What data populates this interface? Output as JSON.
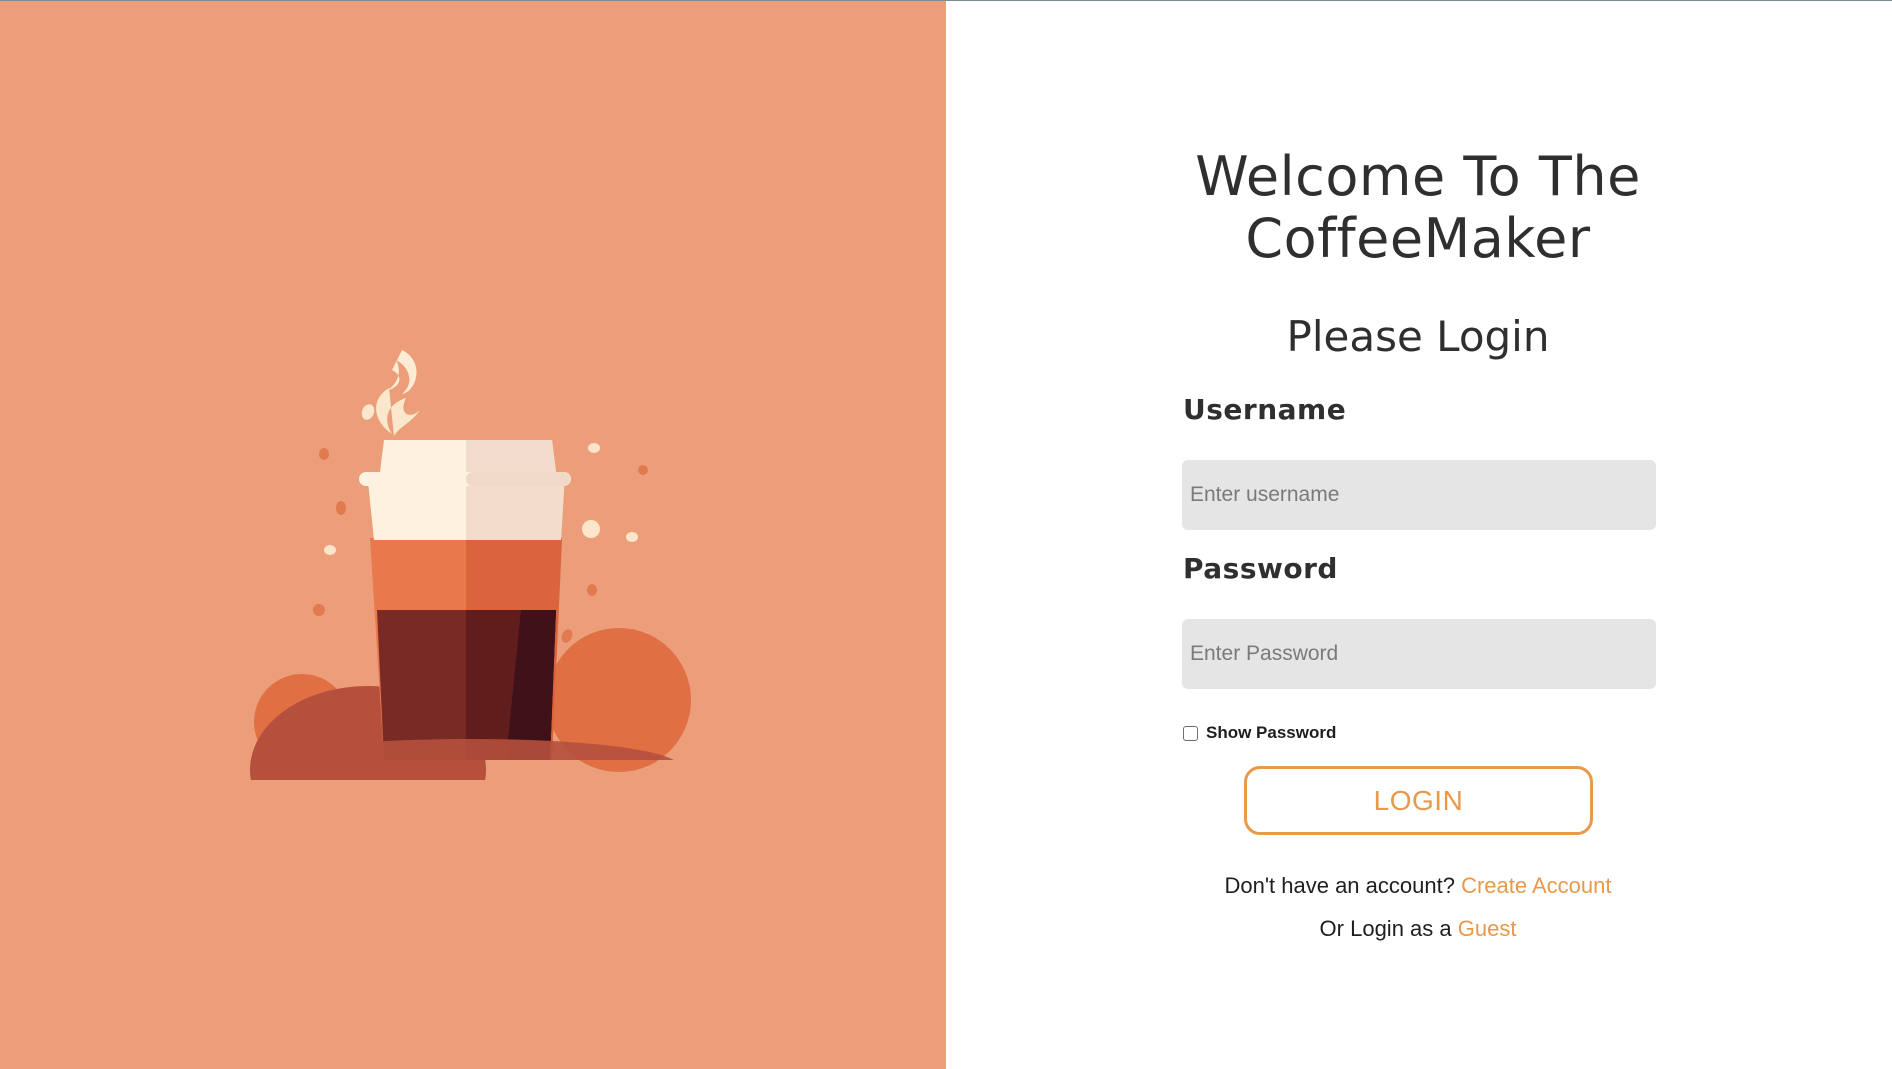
{
  "colors": {
    "left_panel_bg": "#ec9d79",
    "accent": "#e8994b",
    "input_bg": "#e5e5e5",
    "text_dark": "#2f2f2f"
  },
  "hero": {
    "illustration": "coffee-cup-illustration"
  },
  "login": {
    "title": "Welcome To The CoffeeMaker",
    "subtitle": "Please Login",
    "username_label": "Username",
    "username_placeholder": "Enter username",
    "username_value": "",
    "password_label": "Password",
    "password_placeholder": "Enter Password",
    "password_value": "",
    "show_password_label": "Show Password",
    "show_password_checked": false,
    "login_button": "LOGIN",
    "signup_prompt": "Don't have an account?",
    "signup_link": "Create Account",
    "guest_prompt": "Or Login as a",
    "guest_link": "Guest"
  }
}
